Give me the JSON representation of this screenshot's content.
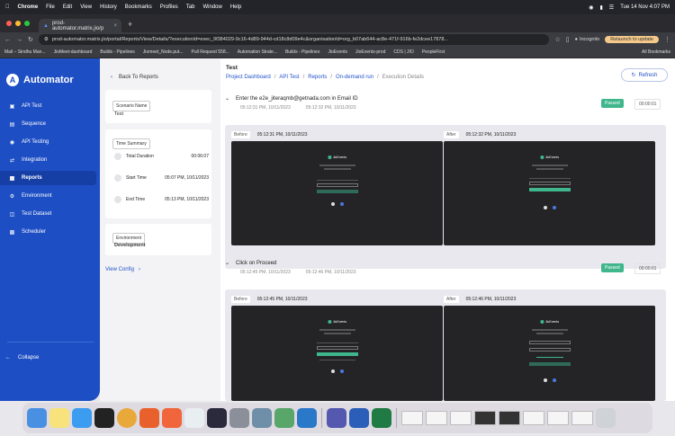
{
  "menubar": {
    "app": "Chrome",
    "items": [
      "File",
      "Edit",
      "View",
      "History",
      "Bookmarks",
      "Profiles",
      "Tab",
      "Window",
      "Help"
    ],
    "clock": "Tue 14 Nov 4:07 PM"
  },
  "browser": {
    "tab_title": "prod-automator.matrix.jio/p",
    "url": "prod-automator.matrix.jio/portal/Reports/View/Details/?executionId=exec_9f384029-9c16-4d89-944d-cd18c8d09e4c&organisationId=org_b07ab644-ac8e-471f-916b-fe2dcee17878...",
    "incognito": "Incognito",
    "relaunch": "Relaunch to update",
    "bookmarks": [
      "Mail – Sindhu Man...",
      "JioMeet-dashboard",
      "Builds - Pipelines",
      "Jiomeet_Node.put...",
      "Pull Request 558...",
      "Automation Strate...",
      "Builds - Pipelines",
      "JioEvents",
      "JioEvents-prod",
      "CDS | JIO",
      "PeopleFirst"
    ],
    "all_bookmarks": "All Bookmarks"
  },
  "sidebar": {
    "brand": "Automator",
    "items": [
      {
        "label": "API Test",
        "icon": "api-icon"
      },
      {
        "label": "Sequence",
        "icon": "sequence-icon"
      },
      {
        "label": "API Testing",
        "icon": "api-testing-icon"
      },
      {
        "label": "Integration",
        "icon": "integration-icon"
      },
      {
        "label": "Reports",
        "icon": "reports-icon"
      },
      {
        "label": "Environment",
        "icon": "environment-icon"
      },
      {
        "label": "Test Dataset",
        "icon": "dataset-icon"
      },
      {
        "label": "Scheduler",
        "icon": "scheduler-icon"
      }
    ],
    "active": "Reports",
    "collapse": "Collapse"
  },
  "panel": {
    "back": "Back To Reports",
    "scenario_chip": "Scenario Name",
    "scenario_value": "Test",
    "time_chip": "Time Summary",
    "total_label": "Total Duration",
    "total_value": "00:06:07",
    "start_label": "Start Time",
    "start_value": "05:07 PM, 10/11/2023",
    "end_label": "End Time",
    "end_value": "05:13 PM, 10/11/2023",
    "env_chip": "Environment",
    "env_value": "Development",
    "view_config": "View Config"
  },
  "main": {
    "title": "Test",
    "breadcrumb": [
      "Project Dashboard",
      "API Test",
      "Reports",
      "On-demand run",
      "Execution Details"
    ],
    "refresh": "Refresh",
    "steps": [
      {
        "title": "Enter the e2e_jiteraqmb@getnada.com in Email ID",
        "start": "05:12:31 PM, 10/11/2023",
        "end": "05:12:32 PM, 10/11/2023",
        "status": "Passed",
        "duration": "00:00:01",
        "before_label": "Before",
        "before_time": "05:12:31 PM, 10/11/2023",
        "after_label": "After",
        "after_time": "05:12:32 PM, 10/11/2023"
      },
      {
        "title": "Click on Proceed",
        "start": "05:12:45 PM, 10/11/2023",
        "end": "05:12:46 PM, 10/11/2023",
        "status": "Passed",
        "duration": "00:00:01",
        "before_label": "Before",
        "before_time": "05:12:45 PM, 10/11/2023",
        "after_label": "After",
        "after_time": "05:12:46 PM, 10/11/2023"
      }
    ],
    "screen_brand": "JioEvents"
  },
  "colors": {
    "sidebar": "#1d4ec4",
    "accent": "#2152c8",
    "passed": "#3fb68c"
  }
}
